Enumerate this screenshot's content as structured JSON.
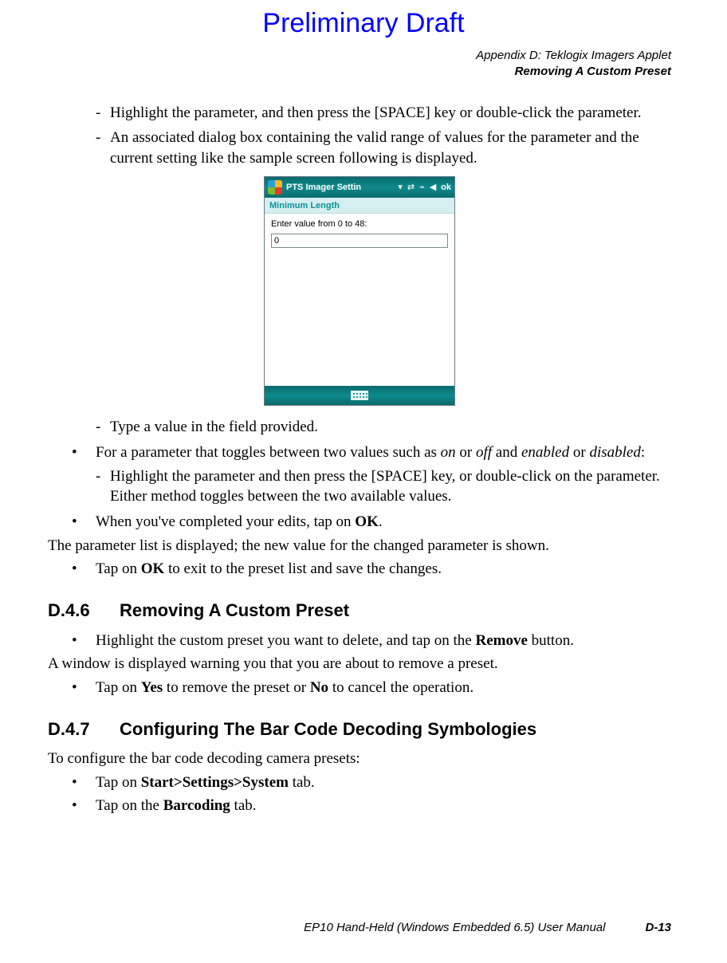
{
  "watermark": "Preliminary Draft",
  "header": {
    "line1": "Appendix D:  Teklogix Imagers Applet",
    "line2": "Removing A Custom Preset"
  },
  "body": {
    "dash1": "Highlight the parameter, and then press the [SPACE] key or double-click the parameter.",
    "dash2": "An associated dialog box containing the valid range of values for the parameter and the current setting like the sample screen following is displayed.",
    "dash3": "Type a value in the field provided.",
    "bullet1_a": "For a parameter that toggles between two values such as ",
    "bullet1_on": "on",
    "bullet1_or1": " or ",
    "bullet1_off": "off",
    "bullet1_and": " and ",
    "bullet1_enabled": "enabled",
    "bullet1_or2": " or ",
    "bullet1_disabled": "disabled",
    "bullet1_colon": ":",
    "dash4": "Highlight the parameter and then press the [SPACE] key, or double-click on the parameter. Either method toggles between the two available values.",
    "bullet2_a": "When you've completed your edits, tap on ",
    "bullet2_ok": "OK",
    "bullet2_b": ".",
    "para1": "The parameter list is displayed; the new value for the changed parameter is shown.",
    "bullet3_a": "Tap on ",
    "bullet3_ok": "OK",
    "bullet3_b": " to exit to the preset list and save the changes.",
    "sec6_num": "D.4.6",
    "sec6_title": "Removing A Custom Preset",
    "sec6_b1a": "Highlight the custom preset you want to delete, and tap on the ",
    "sec6_b1b": "Remove",
    "sec6_b1c": " button.",
    "sec6_p1": "A window is displayed warning you that you are about to remove a preset.",
    "sec6_b2a": "Tap on ",
    "sec6_b2b": "Yes",
    "sec6_b2c": " to remove the preset or ",
    "sec6_b2d": "No",
    "sec6_b2e": " to cancel the operation.",
    "sec7_num": "D.4.7",
    "sec7_title": "Configuring The Bar Code Decoding Symbologies",
    "sec7_p1": "To configure the bar code decoding camera presets:",
    "sec7_b1a": "Tap on ",
    "sec7_b1b": "Start>Settings>System",
    "sec7_b1c": " tab.",
    "sec7_b2a": "Tap on the ",
    "sec7_b2b": "Barcoding",
    "sec7_b2c": " tab."
  },
  "device": {
    "title": "PTS Imager Settin",
    "subbar": "Minimum Length",
    "prompt": "Enter value from 0 to 48:",
    "value": "0",
    "ok": "ok"
  },
  "footer": {
    "manual": "EP10 Hand-Held (Windows Embedded 6.5) User Manual",
    "page": "D-13"
  }
}
